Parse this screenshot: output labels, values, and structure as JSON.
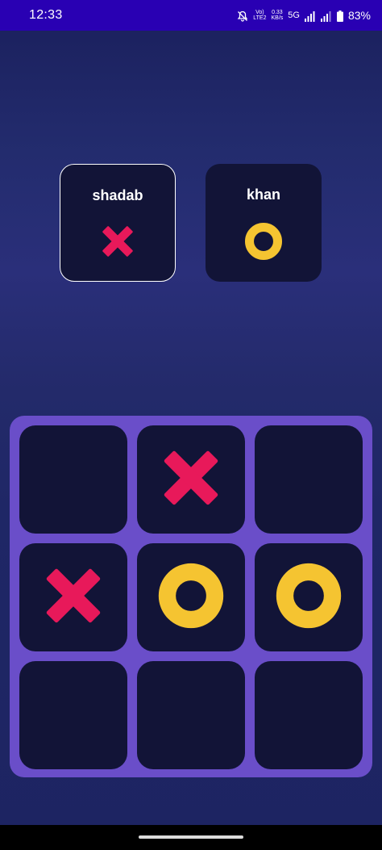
{
  "status_bar": {
    "time": "12:33",
    "volte_line1": "Vo)",
    "volte_line2": "LTE2",
    "speed_line1": "0.33",
    "speed_line2": "KB/s",
    "network": "5G",
    "battery_percent": "83%",
    "icons": [
      "mute-icon",
      "signal-icon",
      "signal-icon",
      "battery-icon"
    ]
  },
  "players": [
    {
      "name": "shadab",
      "mark": "X",
      "active": true
    },
    {
      "name": "khan",
      "mark": "O",
      "active": false
    }
  ],
  "board": {
    "cells": [
      "",
      "X",
      "",
      "X",
      "O",
      "O",
      "",
      "",
      ""
    ]
  },
  "colors": {
    "x_color": "#e8195a",
    "o_color": "#f5c431",
    "board_frame": "#6a4ec9",
    "cell_bg": "#121437",
    "status_bar": "#2900b3"
  }
}
